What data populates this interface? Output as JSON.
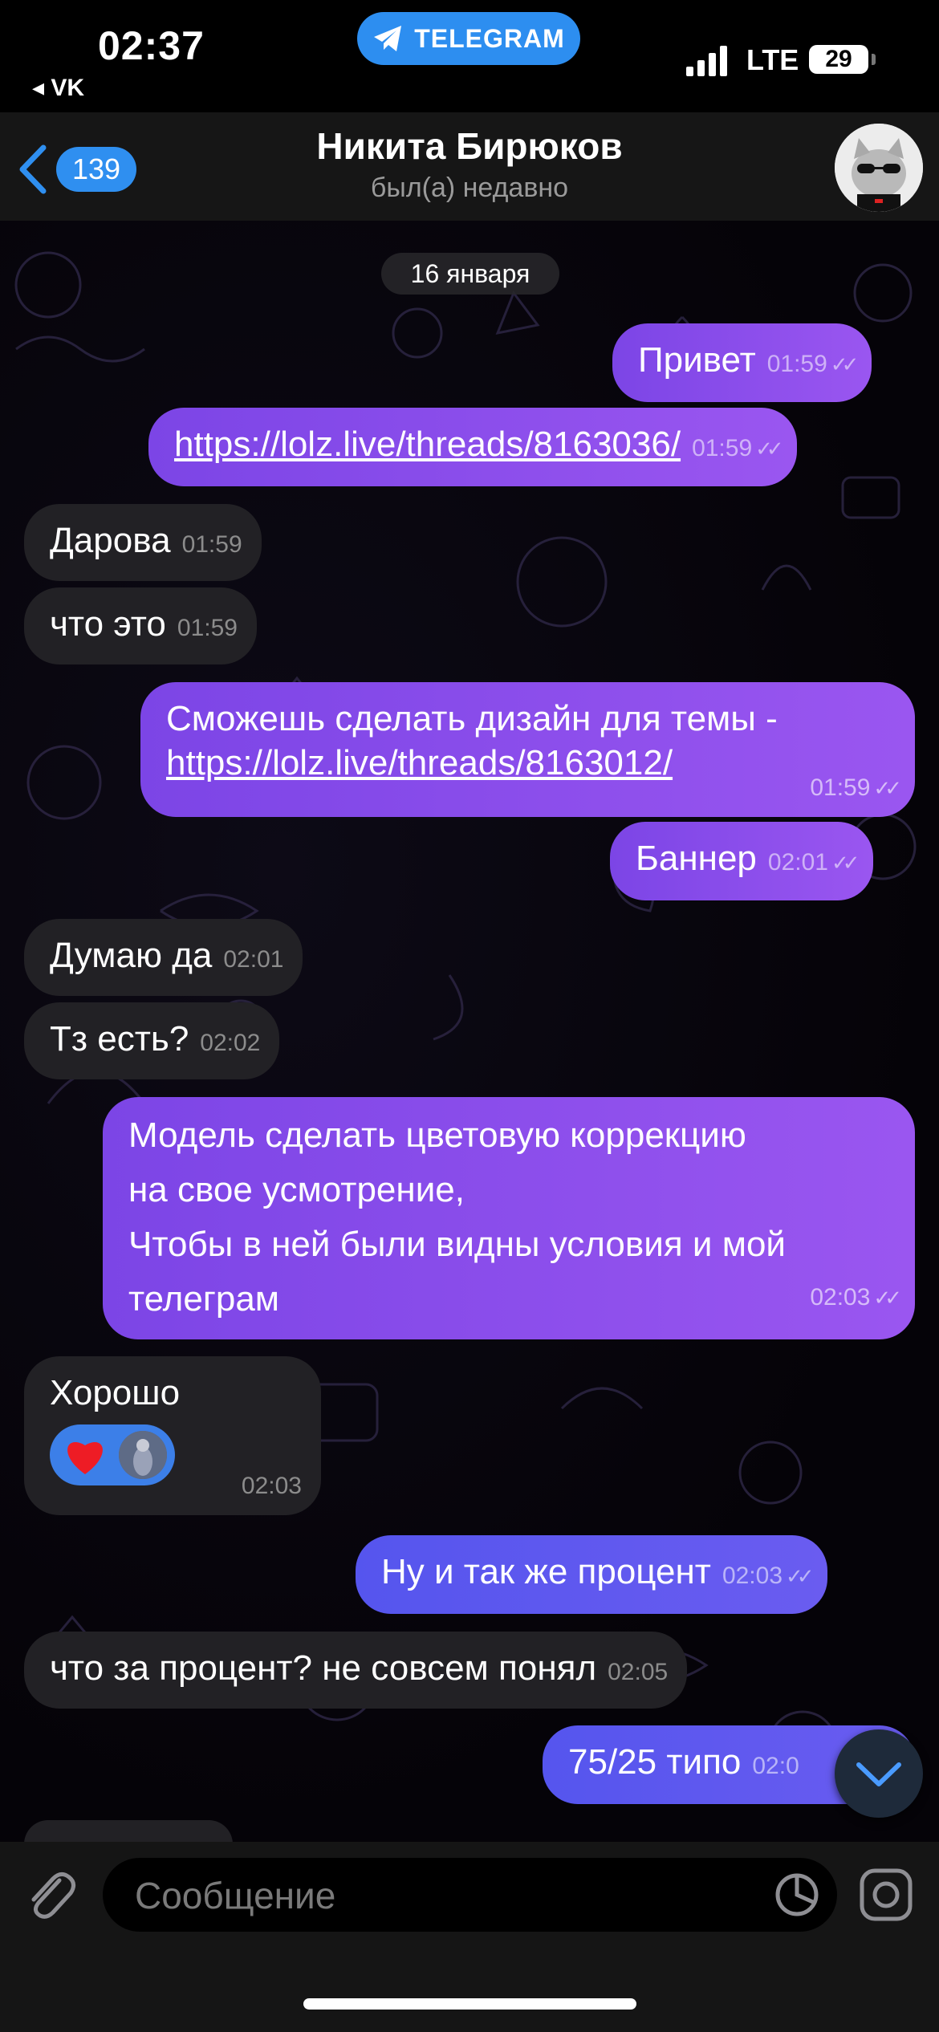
{
  "status_bar": {
    "time": "02:37",
    "back_app": "◂ VK",
    "pill_label": "TELEGRAM",
    "network": "LTE",
    "battery": "29"
  },
  "header": {
    "back_count": "139",
    "name": "Никита Бирюков",
    "status": "был(а) недавно"
  },
  "date_badge": "16 января",
  "messages": [
    {
      "dir": "out",
      "text": "Привет",
      "time": "01:59"
    },
    {
      "dir": "out",
      "link": "https://lolz.live/threads/8163036/",
      "time": "01:59"
    },
    {
      "dir": "in",
      "text": "Дарова",
      "time": "01:59"
    },
    {
      "dir": "in",
      "text": "что это",
      "time": "01:59"
    },
    {
      "dir": "out",
      "text": "Сможешь сделать дизайн для темы -",
      "link": "https://lolz.live/threads/8163012/",
      "time": "01:59"
    },
    {
      "dir": "out",
      "text": "Баннер",
      "time": "02:01"
    },
    {
      "dir": "in",
      "text": "Думаю да",
      "time": "02:01"
    },
    {
      "dir": "in",
      "text": "Тз есть?",
      "time": "02:02"
    },
    {
      "dir": "out",
      "lines": [
        "Модель сделать цветовую коррекцию",
        "на свое усмотрение,",
        "Чтобы в ней были видны условия и мой",
        "телеграм"
      ],
      "time": "02:03"
    },
    {
      "dir": "in",
      "text": "Хорошо",
      "reaction": "❤️",
      "time": "02:03"
    },
    {
      "dir": "out",
      "text": "Ну и так же процент",
      "time": "02:03"
    },
    {
      "dir": "in",
      "text": "что за процент? не совсем понял",
      "time": "02:05"
    },
    {
      "dir": "out",
      "text": "75/25 типо",
      "time": "02:0"
    }
  ],
  "input": {
    "placeholder": "Сообщение"
  },
  "colors": {
    "outgoing": "#8a4dec",
    "outgoing_late": "#5f58ef",
    "incoming": "#222125",
    "accent": "#2f8ff0"
  }
}
